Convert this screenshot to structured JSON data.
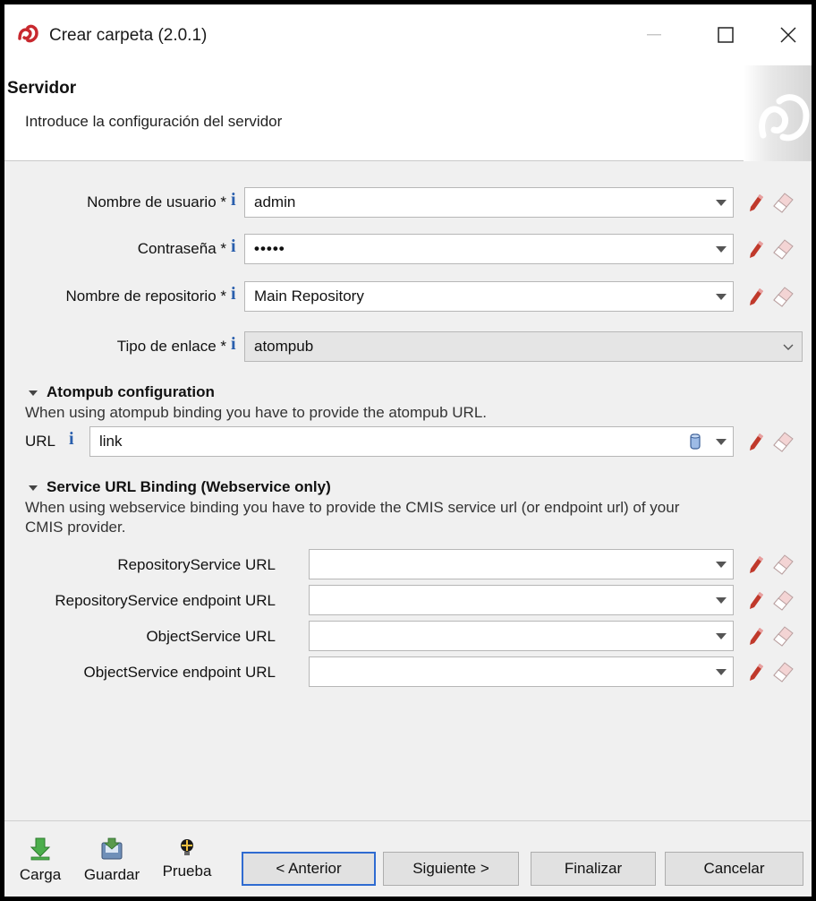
{
  "window": {
    "title": "Crear carpeta (2.0.1)"
  },
  "header": {
    "title": "Servidor",
    "subtitle": "Introduce la configuración del servidor"
  },
  "fields": {
    "username": {
      "label": "Nombre de usuario *",
      "value": "admin"
    },
    "password": {
      "label": "Contraseña *",
      "value": "•••••"
    },
    "repository": {
      "label": "Nombre de repositorio *",
      "value": "Main Repository"
    },
    "binding": {
      "label": "Tipo de enlace *",
      "value": "atompub"
    }
  },
  "atompub": {
    "title": "Atompub configuration",
    "description": "When using atompub binding you have to provide the atompub URL.",
    "url_label": "URL",
    "url_value": "link"
  },
  "webservice": {
    "title": "Service URL Binding (Webservice only)",
    "description_line1": "When using webservice binding you have to provide the CMIS service url (or endpoint url) of your",
    "description_line2": "CMIS provider.",
    "rows": [
      {
        "label": "RepositoryService URL",
        "value": ""
      },
      {
        "label": "RepositoryService endpoint URL",
        "value": ""
      },
      {
        "label": "ObjectService URL",
        "value": ""
      },
      {
        "label": "ObjectService endpoint URL",
        "value": ""
      }
    ]
  },
  "toolbar": {
    "load": "Carga",
    "save": "Guardar",
    "test": "Prueba"
  },
  "buttons": {
    "previous": "< Anterior",
    "next": "Siguiente >",
    "finish": "Finalizar",
    "cancel": "Cancelar"
  },
  "colors": {
    "accent": "#2f6bd1",
    "info": "#2a5fad",
    "pencil": "#c0392b",
    "logo": "#c8282e"
  }
}
